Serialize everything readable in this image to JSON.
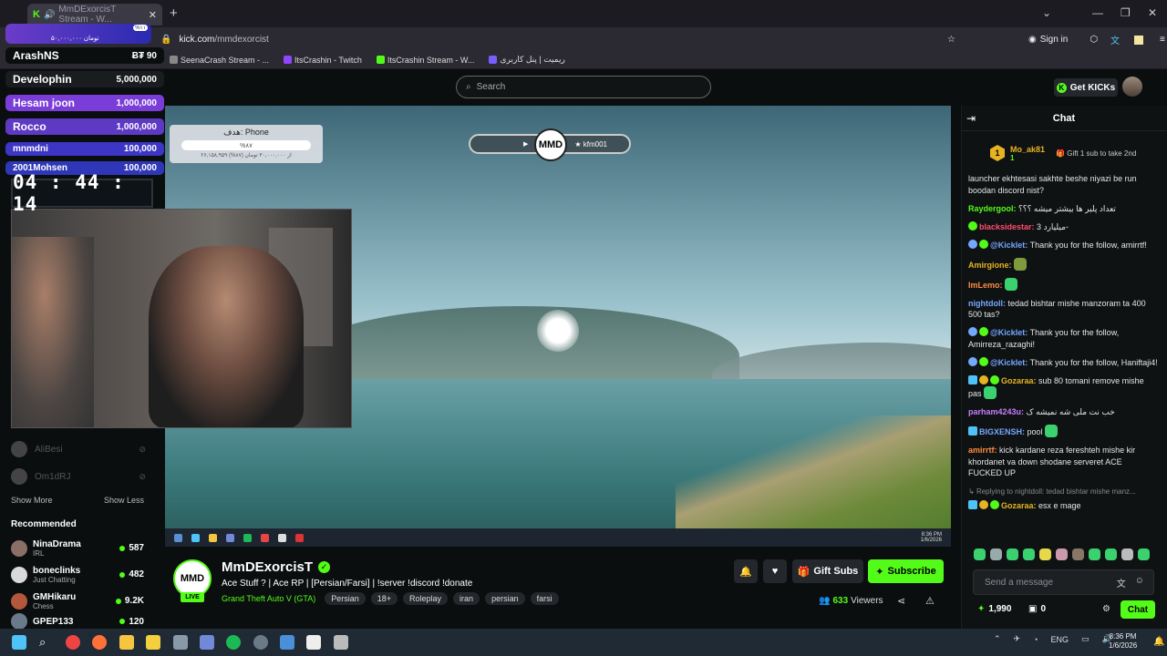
{
  "browser": {
    "tab_title": "MmDExorcisT Stream - W...",
    "url_domain": "kick.com",
    "url_path": "/mmdexorcist",
    "sign_in": "Sign in",
    "bookmarks": [
      {
        "label": "SeenaCrash Stream - ...",
        "color": "#888888"
      },
      {
        "label": "ItsCrashin - Twitch",
        "color": "#9146ff"
      },
      {
        "label": "ItsCrashin Stream - W...",
        "color": "#53fc18"
      },
      {
        "label": "ریمیت | پنل کاربری",
        "color": "#7a5cff"
      }
    ]
  },
  "kick": {
    "search_placeholder": "Search",
    "get_kicks": "Get KICKs"
  },
  "overlay": {
    "mini_progress": {
      "text": "۵۰,۰۰۰,۰۰۰ تومان",
      "pct": "%۱۱"
    },
    "donors": [
      {
        "name": "ArashNS",
        "amount": "Ƀ₮ 90",
        "bg": "#0b0e0f"
      },
      {
        "name": "Develophin",
        "amount": "5,000,000",
        "bg": "#1a1d20"
      },
      {
        "name": "Hesam joon",
        "amount": "1,000,000",
        "bg": "#7a3dd8"
      },
      {
        "name": "Rocco",
        "amount": "1,000,000",
        "bg": "#5e3ac4"
      },
      {
        "name": "mnmdni",
        "amount": "100,000",
        "bg": "#3c35c6"
      },
      {
        "name": "2001Mohsen",
        "amount": "100,000",
        "bg": "#2f37b8"
      }
    ],
    "timer": "04 : 44 : 14",
    "goal_title": "هدف: Phone",
    "goal_pct": "%۸۷",
    "goal_sub": "۲۶,۱۵۸,۹۵۹ از ۳۰,۰۰۰,۰۰۰ تومان (۸۷%)",
    "logo_left_icon": "youtube-icon",
    "logo_text": "MMD",
    "logo_right": "kfm001"
  },
  "sidebar": {
    "followed": [
      {
        "name": "AliBesi"
      },
      {
        "name": "Om1dRJ"
      }
    ],
    "show_more": "Show More",
    "show_less": "Show Less",
    "recommended_title": "Recommended",
    "recommended": [
      {
        "name": "NinaDrama",
        "category": "IRL",
        "viewers": "587",
        "color": "#8a6f66"
      },
      {
        "name": "boneclinks",
        "category": "Just Chatting",
        "viewers": "482",
        "color": "#d9d9d9"
      },
      {
        "name": "GMHikaru",
        "category": "Chess",
        "viewers": "9.2K",
        "color": "#b4573a"
      },
      {
        "name": "GPEP133",
        "category": "",
        "viewers": "120",
        "color": "#6a7a8a"
      }
    ]
  },
  "stream": {
    "channel": "MmDExorcisT",
    "live": "LIVE",
    "title": "Ace Stuff ? | Ace RP | [Persian/Farsi] | !server !discord !donate",
    "game": "Grand Theft Auto V (GTA)",
    "tags": [
      "Persian",
      "18+",
      "Roleplay",
      "iran",
      "persian",
      "farsi"
    ],
    "gift_subs": "Gift Subs",
    "subscribe": "Subscribe",
    "viewers": "633",
    "viewers_label": "Viewers"
  },
  "chat": {
    "title": "Chat",
    "pinned_user": "Mo_ak81",
    "pinned_count": "1",
    "pinned_rank": "1",
    "pinned_gift": "Gift 1 sub to take 2nd",
    "messages": [
      {
        "user": "",
        "color": "#e6e6e6",
        "text": "launcher ekhtesasi sakhte beshe niyazi be run boodan discord nist?"
      },
      {
        "user": "Raydergool:",
        "color": "#53fc18",
        "text": "تعداد پلیر ها بیشتر میشه ؟؟؟"
      },
      {
        "user": "blacksidestar:",
        "color": "#ff4d6d",
        "text": "میلیارد 3-"
      },
      {
        "user": "@Kicklet:",
        "color": "#75a7ff",
        "text": "Thank you for the follow, amirrtf!"
      },
      {
        "user": "Amirgione:",
        "color": "#e6b422",
        "text": ""
      },
      {
        "user": "ImLemo:",
        "color": "#ff8c42",
        "text": ""
      },
      {
        "user": "nightdoll:",
        "color": "#75a7ff",
        "text": "tedad bishtar mishe manzoram ta 400 500 tas?"
      },
      {
        "user": "@Kicklet:",
        "color": "#75a7ff",
        "text": "Thank you for the follow, Amirreza_razaghi!"
      },
      {
        "user": "@Kicklet:",
        "color": "#75a7ff",
        "text": "Thank you for the follow, Haniftaji4!"
      },
      {
        "user": "Gozaraa:",
        "color": "#e6b422",
        "text": "sub 80 tomani remove mishe pas"
      },
      {
        "user": "parham4243u:",
        "color": "#c77dff",
        "text": "خب نت ملی شه نمیشه ک"
      },
      {
        "user": "BIGXENSH:",
        "color": "#75a7ff",
        "text": "pool"
      },
      {
        "user": "amirrtf:",
        "color": "#ff8c42",
        "text": "kick kardane reza fereshteh mishe kir khordanet va down shodane serveret ACE FUCKED UP"
      }
    ],
    "reply_hint": "Replying to nightdoll: tedad bishtar mishe manz...",
    "last_user": "Gozaraa:",
    "last_text": "esx e mage",
    "input_placeholder": "Send a message",
    "kicks_balance": "1,990",
    "gift_balance": "0",
    "chat_button": "Chat"
  },
  "taskbar": {
    "lang": "ENG",
    "time": "8:36 PM",
    "date": "1/6/2026"
  }
}
